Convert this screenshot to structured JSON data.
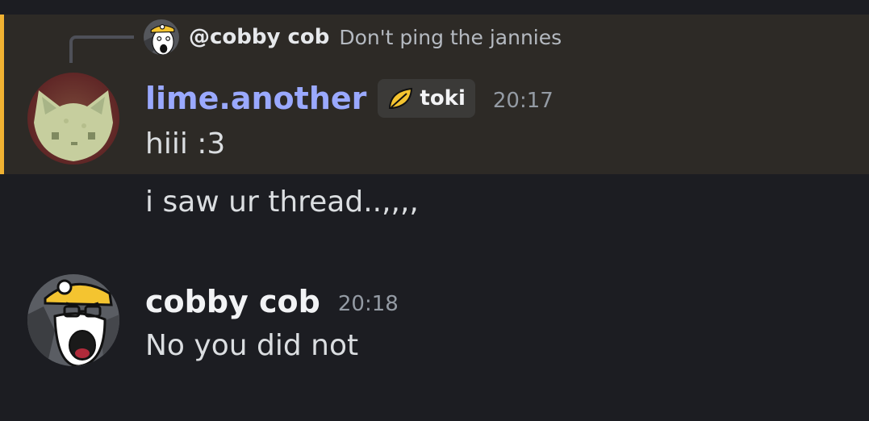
{
  "reply": {
    "author": "@cobby cob",
    "text": "Don't ping the jannies"
  },
  "messages": [
    {
      "author": "lime.another",
      "author_color": "#9aa9ff",
      "badge": {
        "icon": "leaf-icon",
        "label": "toki"
      },
      "timestamp": "20:17",
      "lines": [
        "hiii :3",
        "i saw ur thread..,,,,"
      ],
      "highlighted": true,
      "highlight_color": "#f0b232"
    },
    {
      "author": "cobby cob",
      "author_color": "#f2f3f5",
      "timestamp": "20:18",
      "lines": [
        "No you did not"
      ]
    }
  ]
}
